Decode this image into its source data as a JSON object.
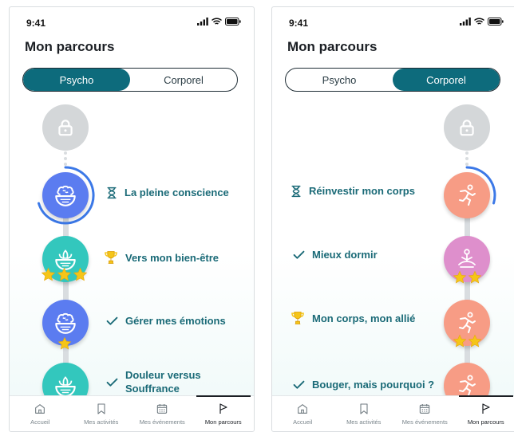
{
  "status": {
    "time": "9:41"
  },
  "screens": [
    {
      "title": "Mon parcours",
      "segments": [
        "Psycho",
        "Corporel"
      ],
      "active_segment": "Psycho",
      "items": [
        {
          "label": "",
          "state": "locked",
          "theme": "locked",
          "node_icon": "lock-icon",
          "stars": 0
        },
        {
          "label": "La pleine conscience",
          "state": "in-progress",
          "theme": "blue",
          "node_icon": "brain-bowl-icon",
          "status_icon": "hourglass-icon",
          "stars": 0
        },
        {
          "label": "Vers mon bien-être",
          "state": "trophy",
          "theme": "teal",
          "node_icon": "lotus-bowl-icon",
          "status_icon": "trophy-icon",
          "stars": 3
        },
        {
          "label": "Gérer mes émotions",
          "state": "done",
          "theme": "blue",
          "node_icon": "brain-bowl-icon",
          "status_icon": "check-icon",
          "stars": 1
        },
        {
          "label": "Douleur versus Souffrance",
          "state": "done",
          "theme": "teal",
          "node_icon": "lotus-bowl-icon",
          "status_icon": "check-icon",
          "stars": 0
        }
      ]
    },
    {
      "title": "Mon parcours",
      "segments": [
        "Psycho",
        "Corporel"
      ],
      "active_segment": "Corporel",
      "items": [
        {
          "label": "",
          "state": "locked",
          "theme": "locked",
          "node_icon": "lock-icon",
          "stars": 0
        },
        {
          "label": "Réinvestir mon corps",
          "state": "in-progress",
          "theme": "coral",
          "node_icon": "running-figure-icon",
          "status_icon": "hourglass-icon",
          "stars": 0
        },
        {
          "label": "Mieux dormir",
          "state": "done",
          "theme": "pink",
          "node_icon": "meditation-icon",
          "status_icon": "check-icon",
          "stars": 2
        },
        {
          "label": "Mon corps, mon allié",
          "state": "trophy",
          "theme": "coral",
          "node_icon": "running-figure-icon",
          "status_icon": "trophy-icon",
          "stars": 2
        },
        {
          "label": "Bouger, mais pourquoi ?",
          "state": "done",
          "theme": "coral",
          "node_icon": "running-figure-icon",
          "status_icon": "check-icon",
          "stars": 0
        }
      ]
    }
  ],
  "tabbar": [
    {
      "label": "Accueil",
      "icon": "home-icon",
      "active": false
    },
    {
      "label": "Mes activités",
      "icon": "bookmark-icon",
      "active": false
    },
    {
      "label": "Mes événements",
      "icon": "calendar-icon",
      "active": false
    },
    {
      "label": "Mon parcours",
      "icon": "flag-icon",
      "active": true
    }
  ],
  "colors": {
    "primary": "#0d6b7c",
    "label": "#1a6a77",
    "star": "#f5c518",
    "progress_ring": "#3b78e7"
  }
}
